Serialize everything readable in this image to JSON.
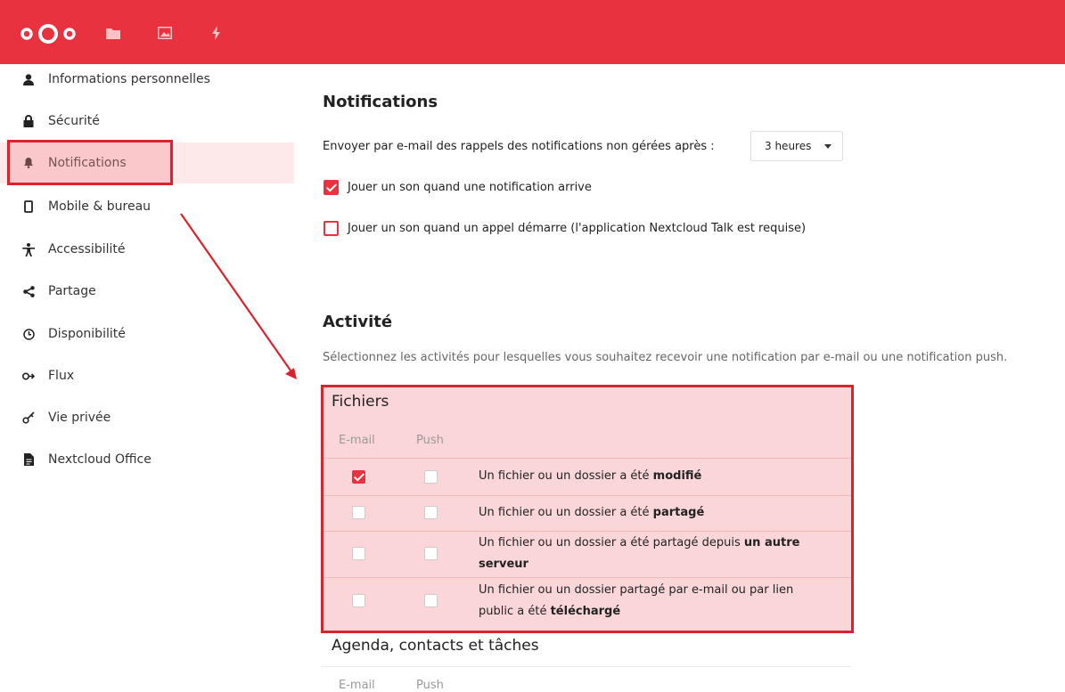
{
  "header": {
    "logo": "nextcloud-logo",
    "apps": [
      "files-icon",
      "photos-icon",
      "activity-icon"
    ],
    "color": "#e9323f"
  },
  "sidebar": {
    "items": [
      {
        "label": "Informations personnelles",
        "icon": "person-icon"
      },
      {
        "label": "Sécurité",
        "icon": "lock-icon"
      },
      {
        "label": "Notifications",
        "icon": "bell-icon",
        "active": true
      },
      {
        "label": "Mobile & bureau",
        "icon": "phone-icon"
      },
      {
        "label": "Accessibilité",
        "icon": "accessibility-icon"
      },
      {
        "label": "Partage",
        "icon": "share-icon"
      },
      {
        "label": "Disponibilité",
        "icon": "clock-icon"
      },
      {
        "label": "Flux",
        "icon": "flux-icon"
      },
      {
        "label": "Vie privée",
        "icon": "key-icon"
      },
      {
        "label": "Nextcloud Office",
        "icon": "document-icon"
      }
    ]
  },
  "notifications": {
    "title": "Notifications",
    "email_reminder_label": "Envoyer par e-mail des rappels des notifications non gérées après :",
    "email_reminder_value": "3 heures",
    "sound_notification_label": "Jouer un son quand une notification arrive",
    "sound_notification_checked": true,
    "sound_call_label": "Jouer un son quand un appel démarre (l'application Nextcloud Talk est requise)",
    "sound_call_checked": false
  },
  "activity": {
    "title": "Activité",
    "description": "Sélectionnez les activités pour lesquelles vous souhaitez recevoir une notification par e-mail ou une notification push.",
    "columns": {
      "email": "E-mail",
      "push": "Push"
    },
    "groups": [
      {
        "title": "Fichiers",
        "rows": [
          {
            "text": "Un fichier ou un dossier a été ",
            "bold": "modifié",
            "email": true,
            "push": false
          },
          {
            "text": "Un fichier ou un dossier a été ",
            "bold": "partagé",
            "email": false,
            "push": false
          },
          {
            "text_line1": "Un fichier ou un dossier a été partagé depuis ",
            "bold_line1": "un autre",
            "bold_line2": "serveur",
            "email": false,
            "push": false
          },
          {
            "text_line1": "Un fichier ou un dossier partagé par e-mail ou par lien",
            "text_line2": "public a été ",
            "bold_line2": "téléchargé",
            "email": false,
            "push": false
          }
        ]
      },
      {
        "title": "Agenda, contacts et tâches",
        "rows": []
      }
    ]
  }
}
